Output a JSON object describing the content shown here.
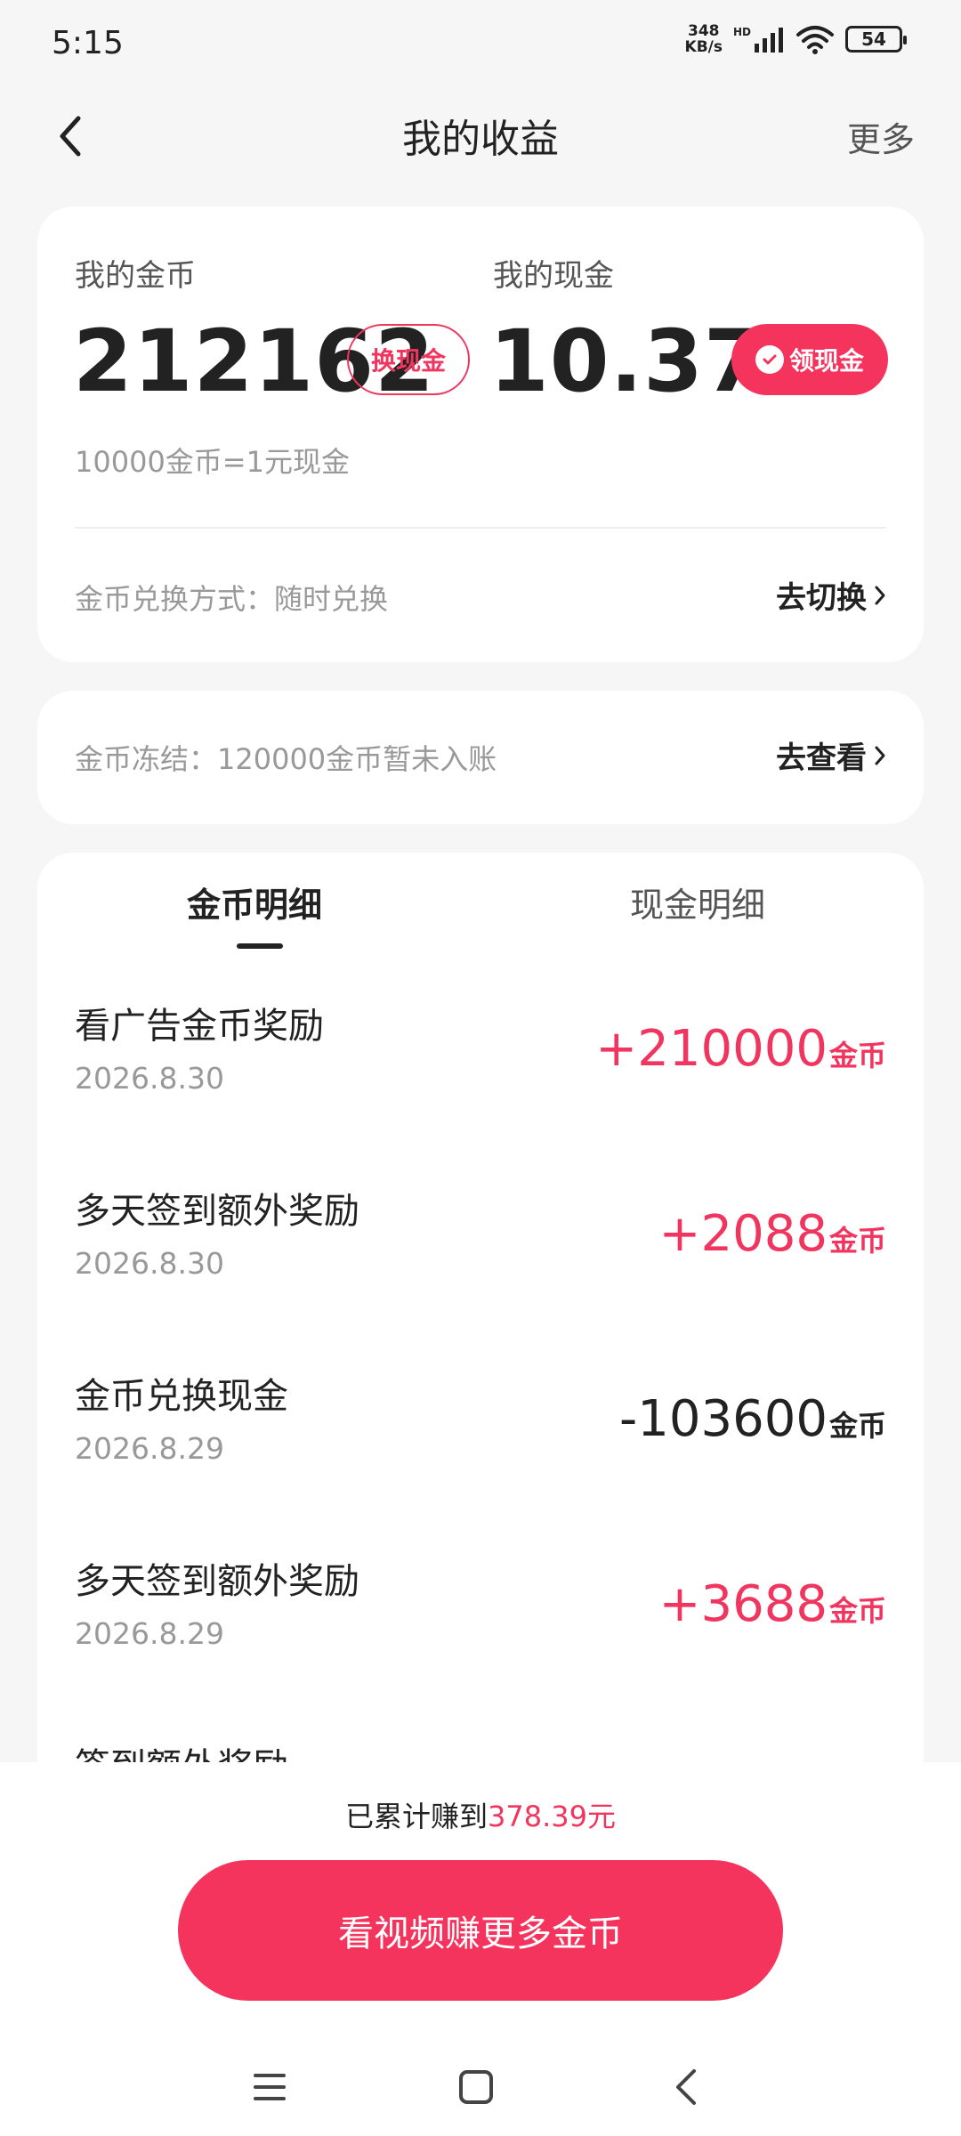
{
  "status": {
    "time": "5:15",
    "net_speed_value": "348",
    "net_speed_unit": "KB/s",
    "hd": "HD",
    "battery": "54"
  },
  "header": {
    "title": "我的收益",
    "more": "更多"
  },
  "balance": {
    "coins_label": "我的金币",
    "coins_value": "212162",
    "exchange_button": "换现金",
    "cash_label": "我的现金",
    "cash_value": "10.37",
    "withdraw_button": "领现金",
    "rate_text": "10000金币=1元现金",
    "mode_text": "金币兑换方式：随时兑换",
    "switch_link": "去切换"
  },
  "frozen": {
    "text": "金币冻结：120000金币暂未入账",
    "view_link": "去查看"
  },
  "tabs": {
    "coin_detail": "金币明细",
    "cash_detail": "现金明细"
  },
  "records": [
    {
      "title": "看广告金币奖励",
      "date": "2026.8.30",
      "amount": "+210000",
      "unit": "金币"
    },
    {
      "title": "多天签到额外奖励",
      "date": "2026.8.30",
      "amount": "+2088",
      "unit": "金币"
    },
    {
      "title": "金币兑换现金",
      "date": "2026.8.29",
      "amount": "-103600",
      "unit": "金币"
    },
    {
      "title": "多天签到额外奖励",
      "date": "2026.8.29",
      "amount": "+3688",
      "unit": "金币"
    },
    {
      "title": "签到额外奖励"
    }
  ],
  "bottom": {
    "earned_prefix": "已累计赚到",
    "earned_value": "378.39元",
    "cta": "看视频赚更多金币"
  },
  "colors": {
    "accent": "#f5345e",
    "background": "#f6f6f6"
  }
}
